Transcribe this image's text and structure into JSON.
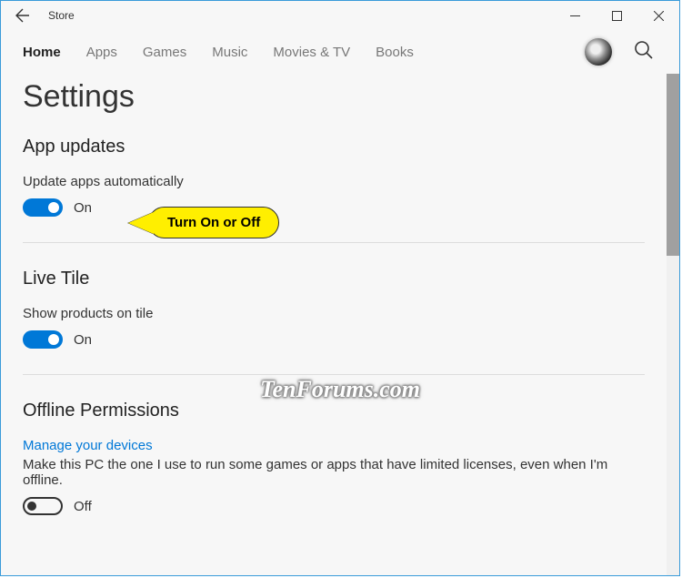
{
  "window": {
    "title": "Store"
  },
  "nav": {
    "items": [
      "Home",
      "Apps",
      "Games",
      "Music",
      "Movies & TV",
      "Books"
    ],
    "activeIndex": 0
  },
  "page": {
    "title": "Settings"
  },
  "sections": {
    "app_updates": {
      "header": "App updates",
      "setting_label": "Update apps automatically",
      "toggle_state": "On"
    },
    "live_tile": {
      "header": "Live Tile",
      "setting_label": "Show products on tile",
      "toggle_state": "On"
    },
    "offline": {
      "header": "Offline Permissions",
      "link": "Manage your devices",
      "desc": "Make this PC the one I use to run some games or apps that have limited licenses, even when I'm offline.",
      "toggle_state": "Off"
    }
  },
  "callout": {
    "text": "Turn On or Off"
  },
  "watermark": "TenForums.com"
}
